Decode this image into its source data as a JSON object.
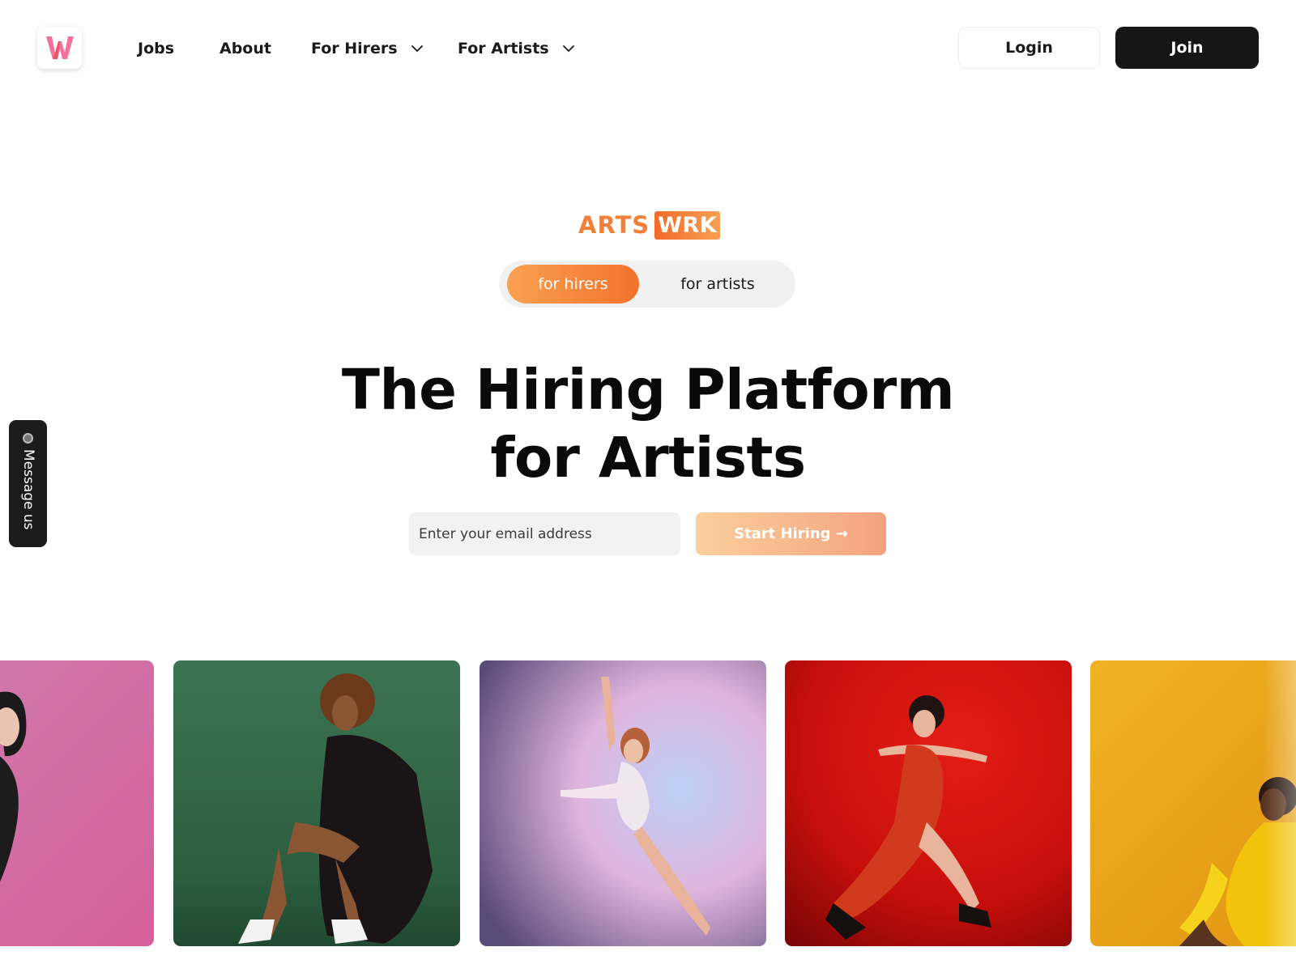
{
  "header": {
    "logo_letter": "W",
    "logo_icon": "w-logo-icon",
    "nav": [
      {
        "label": "Jobs",
        "has_dropdown": false
      },
      {
        "label": "About",
        "has_dropdown": false
      },
      {
        "label": "For Hirers",
        "has_dropdown": true
      },
      {
        "label": "For Artists",
        "has_dropdown": true
      }
    ],
    "login_label": "Login",
    "join_label": "Join"
  },
  "brand": {
    "arts": "ARTS",
    "wrk": "WRK"
  },
  "toggle": {
    "options": [
      "for hirers",
      "for artists"
    ],
    "selected": "for hirers"
  },
  "hero": {
    "headline_line1": "The Hiring Platform",
    "headline_line2": "for Artists",
    "email_placeholder": "Enter your email address",
    "cta_label": "Start Hiring →"
  },
  "message_widget": {
    "label": "Message us"
  },
  "gallery": {
    "cards": [
      {
        "name": "photo-card-pink",
        "background": "#d66fa4"
      },
      {
        "name": "photo-card-green",
        "background": "#2f6447"
      },
      {
        "name": "photo-card-lilac",
        "background": "#c7a3d8"
      },
      {
        "name": "photo-card-red",
        "background": "#d21510"
      },
      {
        "name": "photo-card-yellow",
        "background": "#eda51c"
      }
    ]
  },
  "colors": {
    "brand_orange": "#f4722b",
    "brand_orange_light": "#f9a051",
    "dark": "#161616"
  }
}
